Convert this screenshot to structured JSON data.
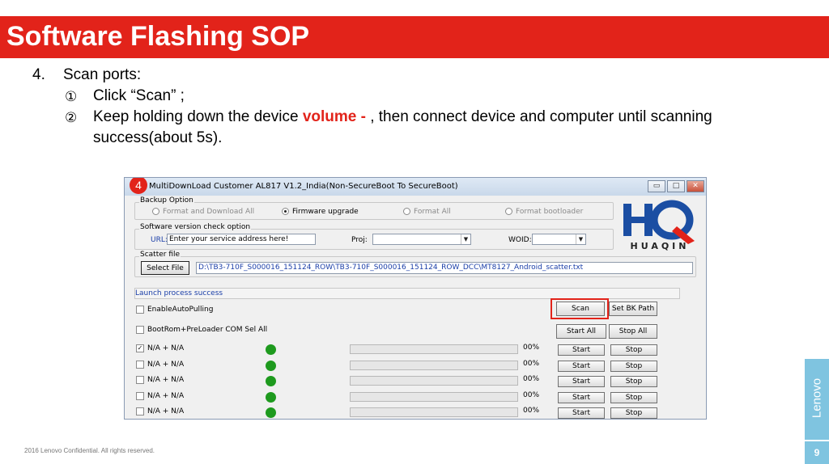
{
  "slide": {
    "title": "Software Flashing SOP",
    "step_number": "4.",
    "step_title": "Scan ports:",
    "sub1_marker": "①",
    "sub1_text": "Click “Scan” ;",
    "sub2_marker": "②",
    "sub2_before": "Keep holding down the device ",
    "sub2_emph": "volume - ",
    "sub2_after": ", then connect device and computer until scanning",
    "sub2_line2": "success(about  5s).",
    "footer": "2016 Lenovo Confidential. All rights reserved.",
    "brand": "Lenovo",
    "page_number": "9",
    "accent_color": "#e2231a",
    "tab_color": "#7fc4e0"
  },
  "window": {
    "badge": "4",
    "title": "MultiDownLoad Customer AL817 V1.2_India(Non-SecureBoot To SecureBoot)",
    "controls": {
      "minimize": "▭",
      "maximize": "□",
      "close": "✕"
    },
    "backup": {
      "label": "Backup Option",
      "options": [
        "Format and Download All",
        "Firmware upgrade",
        "Format All",
        "Format bootloader"
      ],
      "selected": "Firmware upgrade"
    },
    "version_check": {
      "label": "Software version check option",
      "url_label": "URL:",
      "url_value": "Enter your service address here!",
      "proj_label": "Proj:",
      "woid_label": "WOID:"
    },
    "scatter": {
      "label": "Scatter file",
      "button": "Select File",
      "path": "D:\\TB3-710F_S000016_151124_ROW\\TB3-710F_S000016_151124_ROW_DCC\\MT8127_Android_scatter.txt"
    },
    "logo": {
      "letters": "HQ",
      "text": "HUAQIN"
    },
    "status": "Launch process success",
    "enable_auto_pulling": "EnableAutoPulling",
    "bootrom_label": "BootRom+PreLoader COM Sel All",
    "scan_button": "Scan",
    "set_bk_button": "Set BK Path",
    "start_all_button": "Start All",
    "stop_all_button": "Stop All",
    "ports": [
      {
        "label": "N/A + N/A",
        "checked": true,
        "progress": "00%",
        "start": "Start",
        "stop": "Stop"
      },
      {
        "label": "N/A + N/A",
        "checked": false,
        "progress": "00%",
        "start": "Start",
        "stop": "Stop"
      },
      {
        "label": "N/A + N/A",
        "checked": false,
        "progress": "00%",
        "start": "Start",
        "stop": "Stop"
      },
      {
        "label": "N/A + N/A",
        "checked": false,
        "progress": "00%",
        "start": "Start",
        "stop": "Stop"
      },
      {
        "label": "N/A + N/A",
        "checked": false,
        "progress": "00%",
        "start": "Start",
        "stop": "Stop"
      }
    ],
    "checkmark": "✓",
    "dropdown_arrow": "▼"
  }
}
